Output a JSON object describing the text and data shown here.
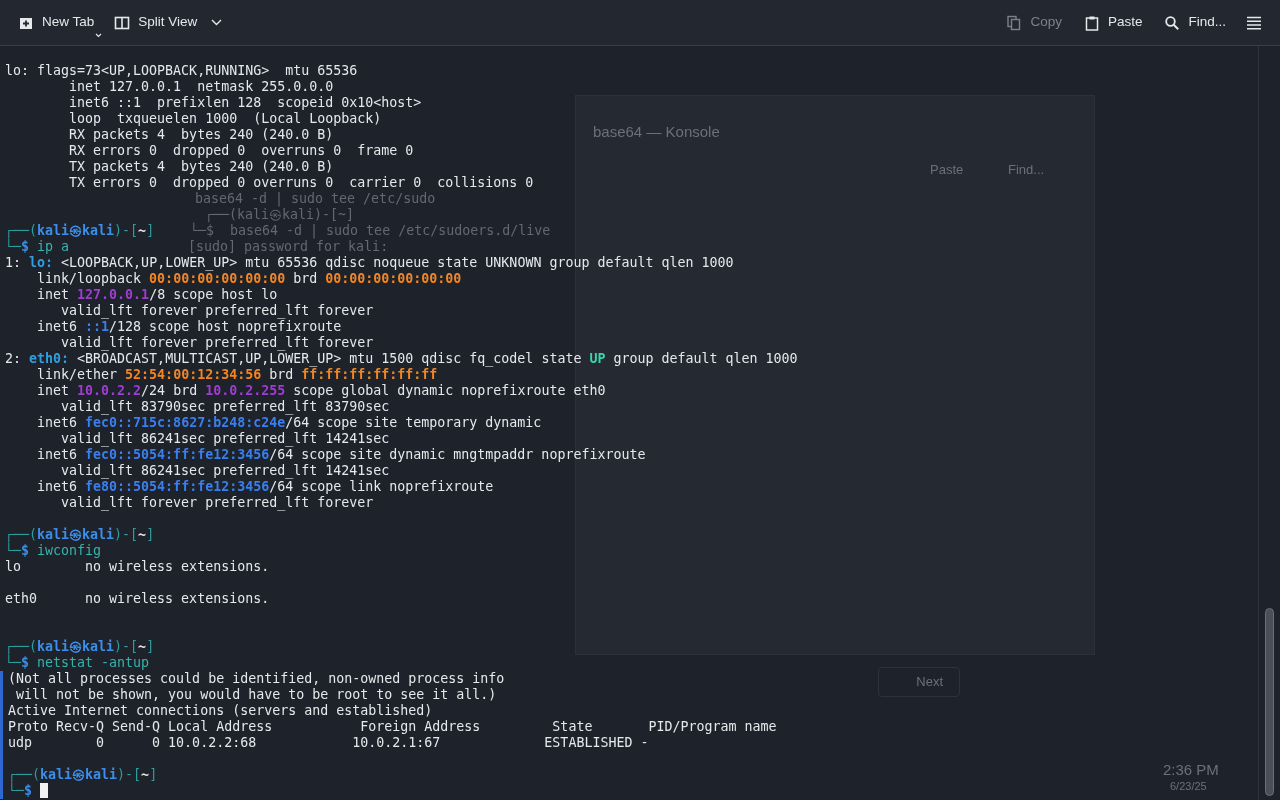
{
  "toolbar": {
    "left": [
      {
        "label": "New Tab",
        "kind": "newtab"
      },
      {
        "label": "Split View",
        "kind": "split"
      }
    ],
    "right": [
      {
        "label": "Copy",
        "kind": "copy",
        "disabled": true
      },
      {
        "label": "Paste",
        "kind": "paste",
        "disabled": false
      },
      {
        "label": "Find...",
        "kind": "search",
        "disabled": false
      }
    ]
  },
  "background": {
    "window_title": "base64 — Konsole",
    "toolbar": [
      "Paste",
      "Find..."
    ],
    "lines": [
      "base64 -d | sudo tee /etc/sudo",
      "┌──(kali㉿kali)-[~]",
      "└─$  base64 -d | sudo tee /etc/sudoers.d/live",
      "[sudo] password for kali: "
    ],
    "next_button": "Next",
    "clock": {
      "time": "2:36 PM",
      "date": "6/23/25"
    }
  },
  "terminal": {
    "lines": [
      {
        "text": "lo: flags=73<UP,LOOPBACK,RUNNING>  mtu 65536",
        "marked": false
      },
      {
        "text": "        inet 127.0.0.1  netmask 255.0.0.0",
        "marked": false
      },
      {
        "text": "        inet6 ::1  prefixlen 128  scopeid 0x10<host>",
        "marked": false
      },
      {
        "text": "        loop  txqueuelen 1000  (Local Loopback)",
        "marked": false
      },
      {
        "text": "        RX packets 4  bytes 240 (240.0 B)",
        "marked": false
      },
      {
        "text": "        RX errors 0  dropped 0  overruns 0  frame 0",
        "marked": false
      },
      {
        "text": "        TX packets 4  bytes 240 (240.0 B)",
        "marked": false
      },
      {
        "text": "        TX errors 0  dropped 0 overruns 0  carrier 0  collisions 0",
        "marked": false,
        "kind": "double"
      },
      {
        "segments": [
          {
            "text": "┌──(",
            "kind": "prompt"
          },
          {
            "text": "kali㉿kali",
            "kind": "user"
          },
          {
            "text": ")-[",
            "kind": "prompt"
          },
          {
            "text": "~",
            "kind": "path"
          },
          {
            "text": "]",
            "kind": "prompt"
          }
        ],
        "marked": false
      },
      {
        "segments": [
          {
            "text": "└─",
            "kind": "prompt"
          },
          {
            "text": "$",
            "kind": "user"
          },
          {
            "text": " ip a",
            "kind": "cmd"
          }
        ],
        "marked": false
      },
      {
        "segments": [
          {
            "text": "1: ",
            "kind": "plain"
          },
          {
            "text": "lo:",
            "kind": "iface"
          },
          {
            "text": " <LOOPBACK,UP,LOWER_UP> mtu 65536 qdisc noqueue state UNKNOWN group default qlen 1000",
            "kind": "plain"
          }
        ],
        "marked": false
      },
      {
        "segments": [
          {
            "text": "    link/loopback ",
            "kind": "plain"
          },
          {
            "text": "00:00:00:00:00:00",
            "kind": "mac"
          },
          {
            "text": " brd ",
            "kind": "plain"
          },
          {
            "text": "00:00:00:00:00:00",
            "kind": "mac"
          }
        ],
        "marked": false
      },
      {
        "segments": [
          {
            "text": "    inet ",
            "kind": "plain"
          },
          {
            "text": "127.0.0.1",
            "kind": "ipv4"
          },
          {
            "text": "/8 scope host lo",
            "kind": "plain"
          }
        ],
        "marked": false
      },
      {
        "text": "       valid_lft forever preferred_lft forever",
        "marked": false
      },
      {
        "segments": [
          {
            "text": "    inet6 ",
            "kind": "plain"
          },
          {
            "text": "::1",
            "kind": "ipv6"
          },
          {
            "text": "/128 scope host noprefixroute",
            "kind": "plain"
          }
        ],
        "marked": false
      },
      {
        "text": "       valid_lft forever preferred_lft forever",
        "marked": false
      },
      {
        "segments": [
          {
            "text": "2: ",
            "kind": "plain"
          },
          {
            "text": "eth0:",
            "kind": "iface"
          },
          {
            "text": " <BROADCAST,MULTICAST,UP,LOWER_UP> mtu 1500 qdisc fq_codel state ",
            "kind": "plain"
          },
          {
            "text": "UP",
            "kind": "up"
          },
          {
            "text": " group default qlen 1000",
            "kind": "plain"
          }
        ],
        "marked": false
      },
      {
        "segments": [
          {
            "text": "    link/ether ",
            "kind": "plain"
          },
          {
            "text": "52:54:00:12:34:56",
            "kind": "mac"
          },
          {
            "text": " brd ",
            "kind": "plain"
          },
          {
            "text": "ff:ff:ff:ff:ff:ff",
            "kind": "mac"
          }
        ],
        "marked": false
      },
      {
        "segments": [
          {
            "text": "    inet ",
            "kind": "plain"
          },
          {
            "text": "10.0.2.2",
            "kind": "ipv4"
          },
          {
            "text": "/24 brd ",
            "kind": "plain"
          },
          {
            "text": "10.0.2.255",
            "kind": "ipv4"
          },
          {
            "text": " scope global dynamic noprefixroute eth0",
            "kind": "plain"
          }
        ],
        "marked": false
      },
      {
        "text": "       valid_lft 83790sec preferred_lft 83790sec",
        "marked": false
      },
      {
        "segments": [
          {
            "text": "    inet6 ",
            "kind": "plain"
          },
          {
            "text": "fec0::715c:8627:b248:c24e",
            "kind": "ipv6"
          },
          {
            "text": "/64 scope site temporary dynamic",
            "kind": "plain"
          }
        ],
        "marked": false
      },
      {
        "text": "       valid_lft 86241sec preferred_lft 14241sec",
        "marked": false
      },
      {
        "segments": [
          {
            "text": "    inet6 ",
            "kind": "plain"
          },
          {
            "text": "fec0::5054:ff:fe12:3456",
            "kind": "ipv6"
          },
          {
            "text": "/64 scope site dynamic mngtmpaddr noprefixroute",
            "kind": "plain"
          }
        ],
        "marked": false
      },
      {
        "text": "       valid_lft 86241sec preferred_lft 14241sec",
        "marked": false
      },
      {
        "segments": [
          {
            "text": "    inet6 ",
            "kind": "plain"
          },
          {
            "text": "fe80::5054:ff:fe12:3456",
            "kind": "ipv6"
          },
          {
            "text": "/64 scope link noprefixroute",
            "kind": "plain"
          }
        ],
        "marked": false
      },
      {
        "text": "       valid_lft forever preferred_lft forever",
        "marked": false,
        "kind": "spaced"
      },
      {
        "segments": [
          {
            "text": "┌──(",
            "kind": "prompt"
          },
          {
            "text": "kali㉿kali",
            "kind": "user"
          },
          {
            "text": ")-[",
            "kind": "prompt"
          },
          {
            "text": "~",
            "kind": "path"
          },
          {
            "text": "]",
            "kind": "prompt"
          }
        ],
        "marked": false
      },
      {
        "segments": [
          {
            "text": "└─",
            "kind": "prompt"
          },
          {
            "text": "$",
            "kind": "user"
          },
          {
            "text": " iwconfig",
            "kind": "cmd"
          }
        ],
        "marked": false
      },
      {
        "text": "lo        no wireless extensions.",
        "marked": false,
        "kind": "spaced"
      },
      {
        "text": "eth0      no wireless extensions.",
        "marked": false,
        "kind": "double"
      },
      {
        "segments": [
          {
            "text": "┌──(",
            "kind": "prompt"
          },
          {
            "text": "kali㉿kali",
            "kind": "user"
          },
          {
            "text": ")-[",
            "kind": "prompt"
          },
          {
            "text": "~",
            "kind": "path"
          },
          {
            "text": "]",
            "kind": "prompt"
          }
        ],
        "marked": false
      },
      {
        "segments": [
          {
            "text": "└─",
            "kind": "prompt"
          },
          {
            "text": "$",
            "kind": "user"
          },
          {
            "text": " netstat -antup",
            "kind": "cmd"
          }
        ],
        "marked": false
      },
      {
        "text": "(Not all processes could be identified, non-owned process info",
        "marked": true
      },
      {
        "text": " will not be shown, you would have to be root to see it all.)",
        "marked": true
      },
      {
        "text": "Active Internet connections (servers and established)",
        "marked": true
      },
      {
        "text": "Proto Recv-Q Send-Q Local Address           Foreign Address         State       PID/Program name",
        "marked": true
      },
      {
        "text": "udp        0      0 10.0.2.2:68            10.0.2.1:67             ESTABLISHED -",
        "marked": true,
        "kind": "spaced"
      },
      {
        "segments": [
          {
            "text": "┌──(",
            "kind": "prompt"
          },
          {
            "text": "kali㉿kali",
            "kind": "user"
          },
          {
            "text": ")-[",
            "kind": "prompt"
          },
          {
            "text": "~",
            "kind": "path"
          },
          {
            "text": "]",
            "kind": "prompt"
          }
        ],
        "marked": true
      },
      {
        "segments": [
          {
            "text": "└─",
            "kind": "prompt"
          },
          {
            "text": "$",
            "kind": "user"
          }
        ],
        "cursor": true,
        "marked": true
      }
    ]
  }
}
